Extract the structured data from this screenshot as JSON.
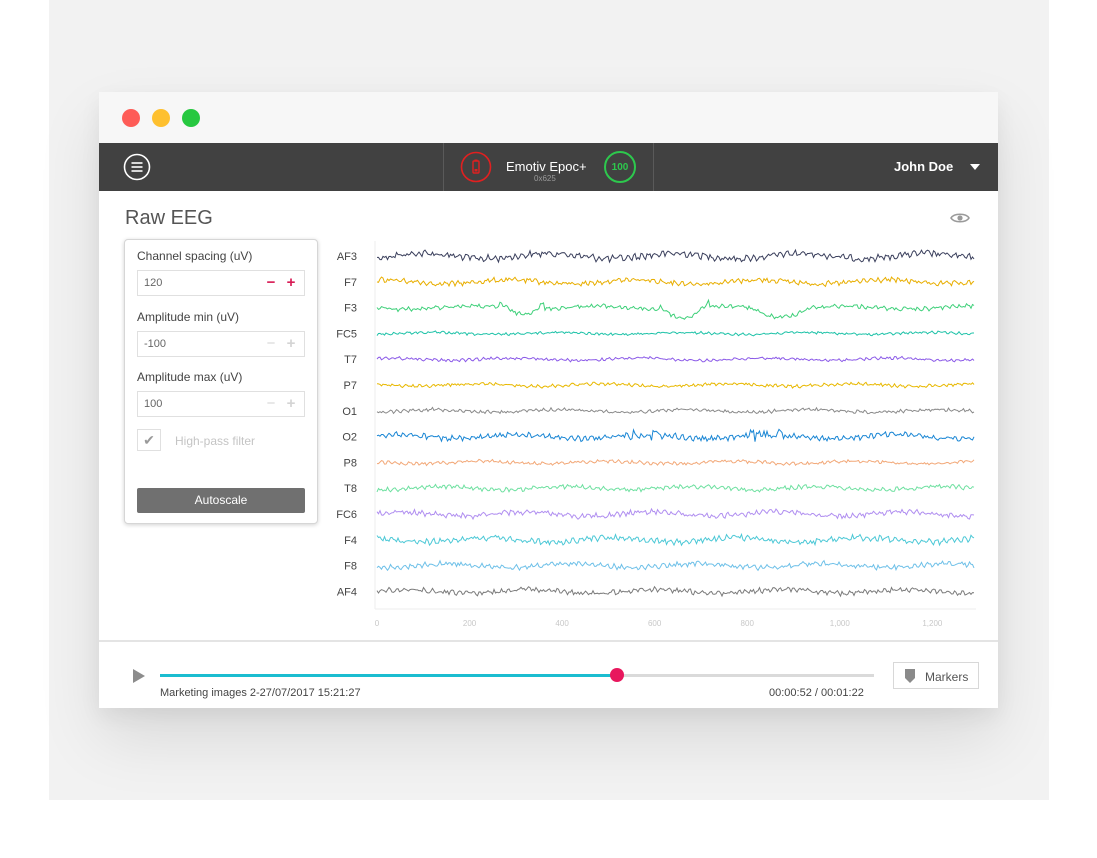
{
  "header": {
    "device_name": "Emotiv Epoc+",
    "device_id": "0x625",
    "signal_quality": "100",
    "user_name": "John Doe"
  },
  "page": {
    "title": "Raw EEG"
  },
  "settings": {
    "channel_spacing": {
      "label": "Channel spacing (uV)",
      "value": "120",
      "minus": "−",
      "plus": "+"
    },
    "amplitude_min": {
      "label": "Amplitude min (uV)",
      "value": "-100",
      "minus": "−",
      "plus": "+"
    },
    "amplitude_max": {
      "label": "Amplitude max (uV)",
      "value": "100",
      "minus": "−",
      "plus": "+"
    },
    "highpass_label": "High-pass filter",
    "highpass_checked": true,
    "autoscale_label": "Autoscale"
  },
  "chart_data": {
    "type": "line",
    "x_ticks": [
      "0",
      "200",
      "400",
      "600",
      "800",
      "1,000",
      "1,200"
    ],
    "xlim": [
      0,
      1290
    ],
    "channels": [
      {
        "name": "AF3",
        "color": "#3a3f5c"
      },
      {
        "name": "F7",
        "color": "#e8ae00"
      },
      {
        "name": "F3",
        "color": "#3fd07a"
      },
      {
        "name": "FC5",
        "color": "#1ec2a8"
      },
      {
        "name": "T7",
        "color": "#8c5be8"
      },
      {
        "name": "P7",
        "color": "#e8b800"
      },
      {
        "name": "O1",
        "color": "#8a8a8a"
      },
      {
        "name": "O2",
        "color": "#1a86d4"
      },
      {
        "name": "P8",
        "color": "#f2a878"
      },
      {
        "name": "T8",
        "color": "#6ee0a0"
      },
      {
        "name": "FC6",
        "color": "#b08ef0"
      },
      {
        "name": "F4",
        "color": "#4cc8d6"
      },
      {
        "name": "F8",
        "color": "#6ec0e8"
      },
      {
        "name": "AF4",
        "color": "#7a7a7a"
      }
    ]
  },
  "player": {
    "progress_fraction": 0.64,
    "recording_name": "Marketing images 2-27/07/2017 15:21:27",
    "time_display": "00:00:52 / 00:01:22",
    "markers_label": "Markers"
  }
}
